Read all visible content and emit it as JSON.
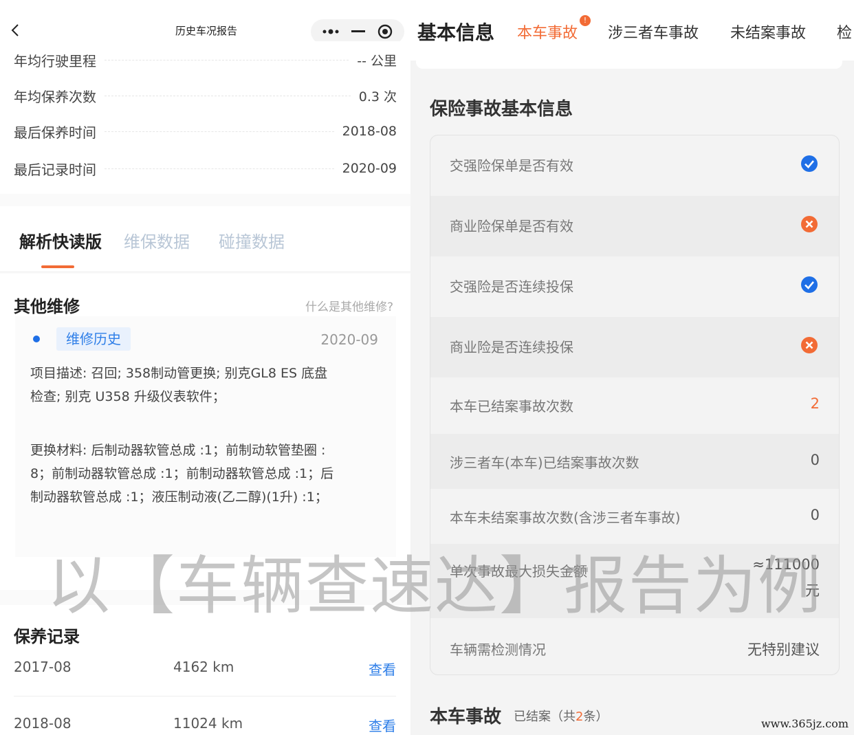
{
  "left": {
    "mini_title": "历史车况报告",
    "stats": [
      {
        "label": "年均行驶里程",
        "value": "-- 公里"
      },
      {
        "label": "年均保养次数",
        "value": "0.3 次"
      },
      {
        "label": "最后保养时间",
        "value": "2018-08"
      },
      {
        "label": "最后记录时间",
        "value": "2020-09"
      }
    ],
    "tabs": [
      "解析快读版",
      "维保数据",
      "碰撞数据"
    ],
    "repair": {
      "title": "其他维修",
      "help": "什么是其他维修?",
      "tag": "维修历史",
      "date": "2020-09",
      "desc_line1": "项目描述: 召回; 358制动管更换; 别克GL8 ES 底盘",
      "desc_line2": "检查; 别克 U358 升级仪表软件；",
      "mat_line1": "更换材料: 后制动器软管总成 :1；前制动软管垫圈 :",
      "mat_line2": "8；前制动器软管总成 :1；前制动器软管总成 :1；后",
      "mat_line3": "制动器软管总成 :1；液压制动液(乙二醇)(1升) :1；"
    },
    "maintenance": {
      "title": "保养记录",
      "rows": [
        {
          "date": "2017-08",
          "km": "4162 km",
          "action": "查看"
        },
        {
          "date": "2018-08",
          "km": "11024 km",
          "action": "查看"
        }
      ]
    }
  },
  "right": {
    "tabs": {
      "main": "基本信息",
      "active": "本车事故",
      "badge": "!",
      "t3": "涉三者车事故",
      "t4": "未结案事故",
      "t5": "检"
    },
    "section_title": "保险事故基本信息",
    "rows": [
      {
        "label": "交强险保单是否有效",
        "icon": "check-icon"
      },
      {
        "label": "商业险保单是否有效",
        "icon": "cross-icon"
      },
      {
        "label": "交强险是否连续投保",
        "icon": "check-icon"
      },
      {
        "label": "商业险是否连续投保",
        "icon": "cross-icon"
      },
      {
        "label": "本车已结案事故次数",
        "value": "2"
      },
      {
        "label": "涉三者车(本车)已结案事故次数",
        "value": "0"
      },
      {
        "label": "本车未结案事故次数(含涉三者车事故)",
        "value": "0"
      },
      {
        "label": "单次事故最大损失金额",
        "value_line1": "≈111000",
        "value_line2": "元"
      },
      {
        "label": "车辆需检测情况",
        "value": "无特别建议"
      }
    ],
    "bottom": {
      "title": "本车事故",
      "sub_prefix": "已结案（共",
      "count": "2",
      "sub_suffix": "条）"
    }
  },
  "overlay": {
    "watermark": "以【车辆查速达】报告为例",
    "site": "www.365jz.com"
  },
  "colors": {
    "accent": "#f26b35",
    "blue": "#1f6fe6",
    "link": "#2f7fe8"
  }
}
